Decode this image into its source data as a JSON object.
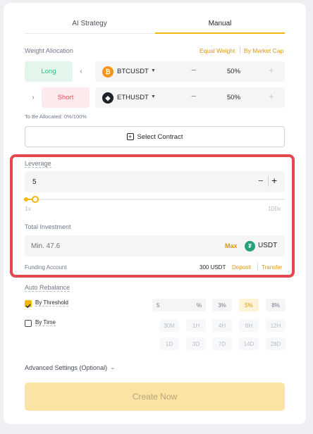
{
  "tabs": [
    {
      "label": "AI Strategy"
    },
    {
      "label": "Manual"
    }
  ],
  "weight": {
    "title": "Weight Allocation",
    "equal_weight": "Equal Weight",
    "by_market_cap": "By Market Cap",
    "rows": [
      {
        "side": "Long",
        "symbol": "BTCUSDT",
        "percent": "50%",
        "side_color": "#2ebd85",
        "coin_color": "#f7931a"
      },
      {
        "side": "Short",
        "symbol": "ETHUSDT",
        "percent": "50%",
        "side_color": "#f6465d",
        "coin_color": "#1e2329"
      }
    ],
    "to_allocate": "To Be Allocated: 0%/100%",
    "select_contract": "Select Contract"
  },
  "leverage": {
    "title": "Leverage",
    "value": "5",
    "min_label": "1x",
    "max_label": "100x",
    "slider_level_fraction": 0.04
  },
  "investment": {
    "title": "Total Investment",
    "placeholder": "Min. 47.6",
    "max_label": "Max",
    "currency": "USDT",
    "funding_label": "Funding Account",
    "funding_value": "300 USDT",
    "deposit": "Deposit",
    "transfer": "Transfer"
  },
  "rebalance": {
    "title": "Auto Rebalance",
    "by_threshold": "By Threshold",
    "by_threshold_checked": true,
    "by_time": "By Time",
    "by_time_checked": false,
    "threshold_input": "5",
    "threshold_unit": "%",
    "threshold_options": [
      "3%",
      "5%",
      "8%"
    ],
    "threshold_active": "5%",
    "time_options_row1": [
      "30M",
      "1H",
      "4H",
      "8H",
      "12H"
    ],
    "time_options_row2": [
      "1D",
      "3D",
      "7D",
      "14D",
      "28D"
    ]
  },
  "advanced": {
    "label": "Advanced Settings (Optional)"
  },
  "create": {
    "label": "Create Now"
  },
  "colors": {
    "accent": "#f0b90b",
    "highlight_border": "#e5484d",
    "long": "#2ebd85",
    "short": "#f6465d"
  }
}
